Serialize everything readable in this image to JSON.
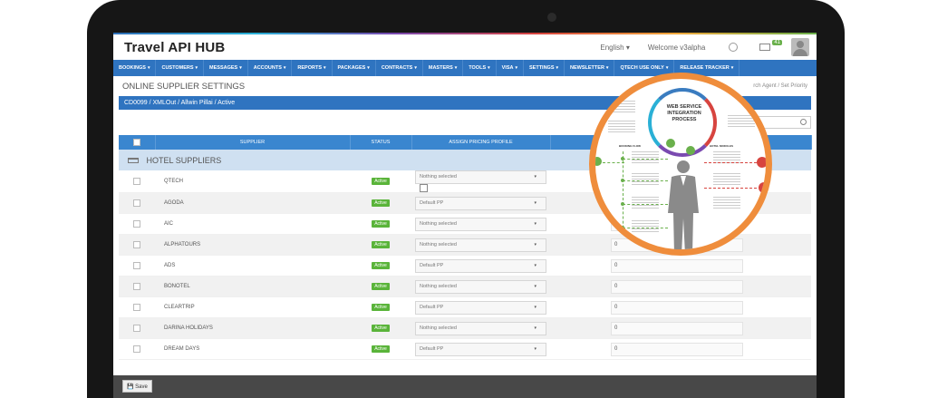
{
  "app": {
    "title": "Travel API HUB",
    "language": "English",
    "welcome": "Welcome v3alpha",
    "mail_count": "41"
  },
  "nav": [
    {
      "label": "BOOKINGS"
    },
    {
      "label": "CUSTOMERS"
    },
    {
      "label": "MESSAGES"
    },
    {
      "label": "ACCOUNTS"
    },
    {
      "label": "REPORTS"
    },
    {
      "label": "PACKAGES"
    },
    {
      "label": "CONTRACTS"
    },
    {
      "label": "MASTERS"
    },
    {
      "label": "TOOLS"
    },
    {
      "label": "VISA"
    },
    {
      "label": "SETTINGS"
    },
    {
      "label": "NEWSLETTER"
    },
    {
      "label": "QTECH USE ONLY"
    },
    {
      "label": "RELEASE TRACKER"
    }
  ],
  "page": {
    "title": "ONLINE SUPPLIER SETTINGS",
    "breadcrumb": "rch Agent  /  Set Priority",
    "info": "CD0099 / XMLOut / Allwin Pillai / Active"
  },
  "table": {
    "headers": {
      "supplier": "SUPPLIER",
      "status": "STATUS",
      "pricing": "ASSIGN PRICING PROFILE"
    },
    "group_label": "HOTEL SUPPLIERS",
    "rows": [
      {
        "supplier": "QTECH",
        "status": "Active",
        "profile": "Nothing selected",
        "value": "0"
      },
      {
        "supplier": "AGODA",
        "status": "Active",
        "profile": "Default PP",
        "value": "0"
      },
      {
        "supplier": "AIC",
        "status": "Active",
        "profile": "Nothing selected",
        "value": "0"
      },
      {
        "supplier": "ALPHATOURS",
        "status": "Active",
        "profile": "Nothing selected",
        "value": "0"
      },
      {
        "supplier": "ADS",
        "status": "Active",
        "profile": "Default PP",
        "value": "0"
      },
      {
        "supplier": "BONOTEL",
        "status": "Active",
        "profile": "Nothing selected",
        "value": "0"
      },
      {
        "supplier": "CLEARTRIP",
        "status": "Active",
        "profile": "Default PP",
        "value": "0"
      },
      {
        "supplier": "DARINA HOLIDAYS",
        "status": "Active",
        "profile": "Nothing selected",
        "value": "0"
      },
      {
        "supplier": "DREAM DAYS",
        "status": "Active",
        "profile": "Default PP",
        "value": "0"
      }
    ]
  },
  "footer": {
    "save_label": "Save"
  },
  "magnifier": {
    "title": "WEB SERVICE INTEGRATION PROCESS",
    "labels": {
      "booking_flow": "BOOKING FLOW",
      "hotel_modules": "HOTEL MODULES"
    }
  },
  "colors": {
    "nav_blue": "#2f74c0",
    "active_green": "#5ab43a",
    "magnifier_orange": "#ef8d3c"
  }
}
